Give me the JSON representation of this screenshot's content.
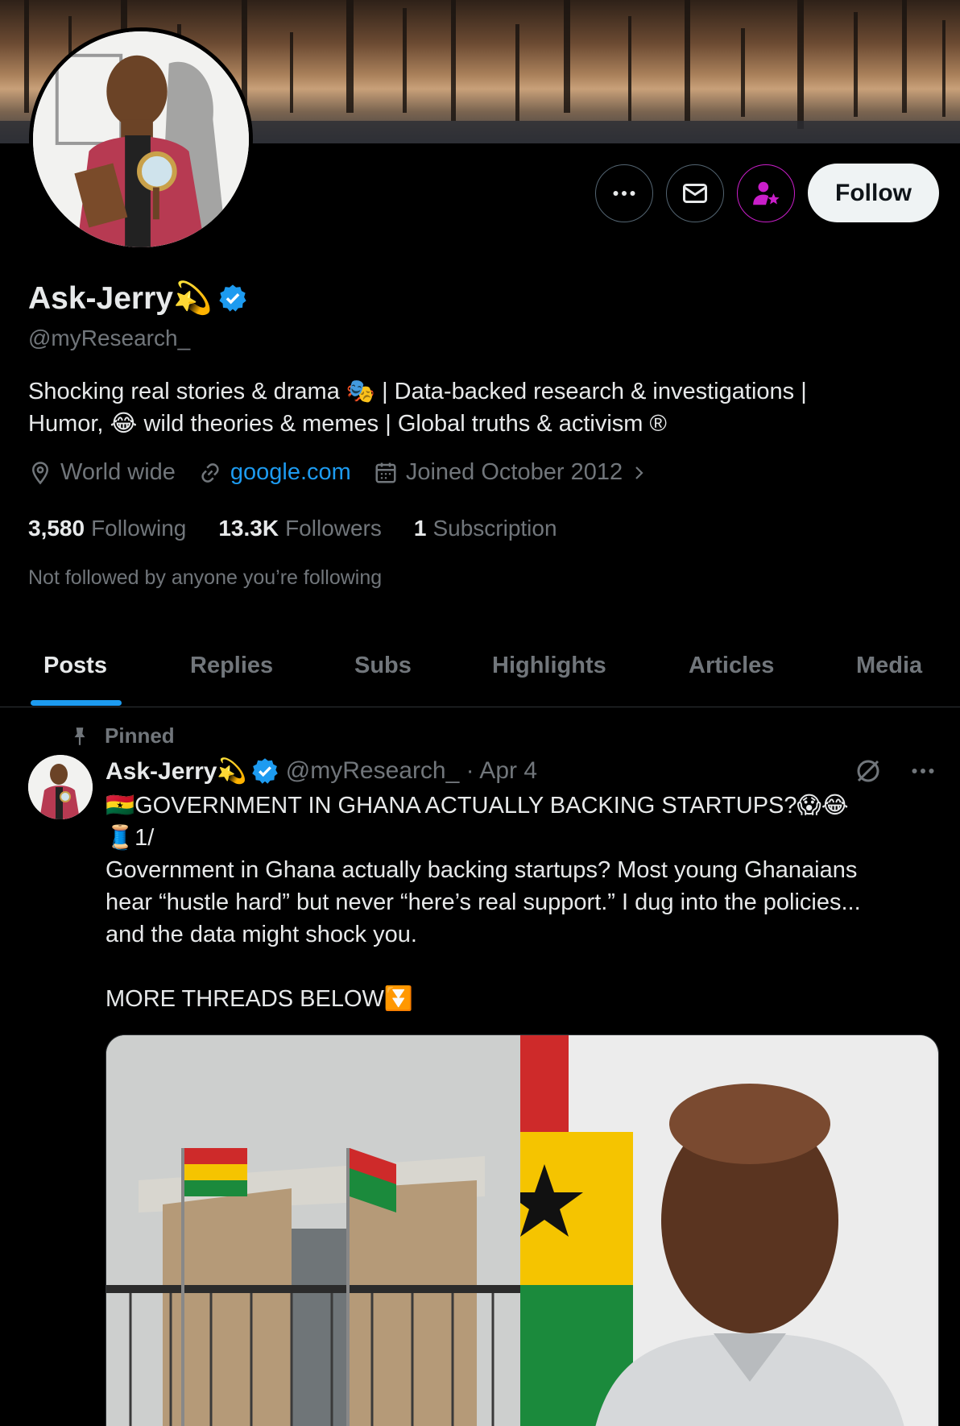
{
  "profile": {
    "display_name": "Ask-Jerry💫",
    "handle": "@myResearch_",
    "bio_line1": "Shocking real stories & drama 🎭  | Data-backed research & investigations  |",
    "bio_line2": "Humor, 😂 wild theories & memes  | Global truths & activism ®",
    "location": "World wide",
    "website": "google.com",
    "joined": "Joined October 2012",
    "following_count": "3,580",
    "following_label": "Following",
    "followers_count": "13.3K",
    "followers_label": "Followers",
    "subscriptions_count": "1",
    "subscriptions_label": "Subscription",
    "not_followed": "Not followed by anyone you’re following"
  },
  "actions": {
    "follow_label": "Follow"
  },
  "tabs": [
    "Posts",
    "Replies",
    "Subs",
    "Highlights",
    "Articles",
    "Media"
  ],
  "active_tab": "Posts",
  "post": {
    "pinned_label": "Pinned",
    "author": "Ask-Jerry💫",
    "handle_date": "@myResearch_ · Apr 4",
    "line1": "🇬🇭GOVERNMENT IN GHANA ACTUALLY BACKING STARTUPS?😱😂",
    "line2": "🧵1/",
    "line3": "Government in Ghana actually backing startups? Most young Ghanaians",
    "line4": "hear “hustle hard” but never “here’s real support.” I dug into the policies...",
    "line5": "and the data might shock you.",
    "line6": "MORE THREADS BELOW⏬"
  },
  "colors": {
    "background": "#000000",
    "accent": "#1d9bf0",
    "muted": "#71767b",
    "subscribe": "#c91ec9"
  }
}
